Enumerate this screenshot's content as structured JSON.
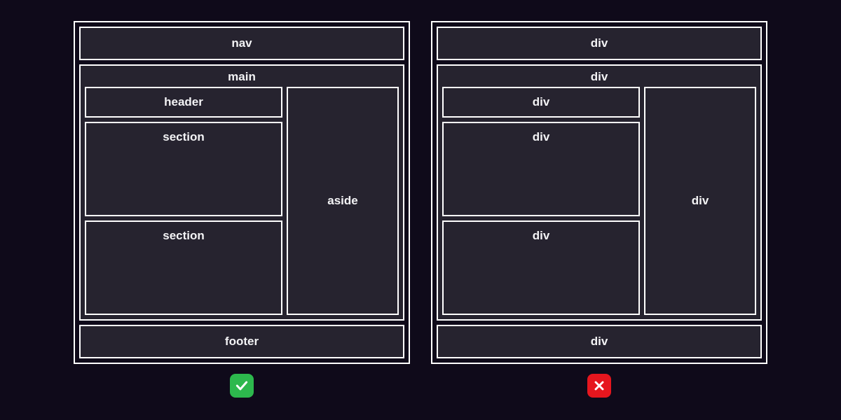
{
  "left": {
    "nav": "nav",
    "main": "main",
    "header": "header",
    "section1": "section",
    "section2": "section",
    "aside": "aside",
    "footer": "footer"
  },
  "right": {
    "nav": "div",
    "main": "div",
    "header": "div",
    "section1": "div",
    "section2": "div",
    "aside": "div",
    "footer": "div"
  },
  "badges": {
    "good_color": "#2db84d",
    "bad_color": "#e6161e"
  }
}
